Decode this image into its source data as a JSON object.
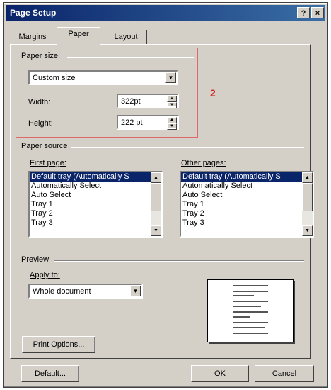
{
  "window": {
    "title": "Page Setup",
    "help_btn": "?",
    "close_btn": "×"
  },
  "tabs": [
    {
      "label": "Margins"
    },
    {
      "label": "Paper"
    },
    {
      "label": "Layout"
    }
  ],
  "annotation": "2",
  "paper_size": {
    "group_label": "Paper size:",
    "selected": "Custom size",
    "width_label": "Width:",
    "width_value": "322pt",
    "height_label": "Height:",
    "height_value": "222 pt"
  },
  "paper_source": {
    "group_label": "Paper source",
    "first_page_label": "First page:",
    "other_pages_label": "Other pages:",
    "first_page_items": [
      "Default tray (Automatically S",
      "Automatically Select",
      "Auto Select",
      "Tray 1",
      "Tray 2",
      "Tray 3"
    ],
    "other_pages_items": [
      "Default tray (Automatically S",
      "Automatically Select",
      "Auto Select",
      "Tray 1",
      "Tray 2",
      "Tray 3"
    ]
  },
  "preview": {
    "group_label": "Preview",
    "apply_to_label": "Apply to:",
    "apply_to_value": "Whole document"
  },
  "buttons": {
    "print_options": "Print Options...",
    "default": "Default...",
    "ok": "OK",
    "cancel": "Cancel"
  },
  "icons": {
    "dropdown": "chevron-down-icon",
    "spinner": "spinner-arrows-icon",
    "scroll_up": "scroll-up-icon",
    "scroll_down": "scroll-down-icon"
  },
  "colors": {
    "dialog_bg": "#d4d0c8",
    "title_start": "#0a246a",
    "title_end": "#3a6ea5",
    "selection": "#0a246a",
    "annotation": "#d42a2a"
  }
}
